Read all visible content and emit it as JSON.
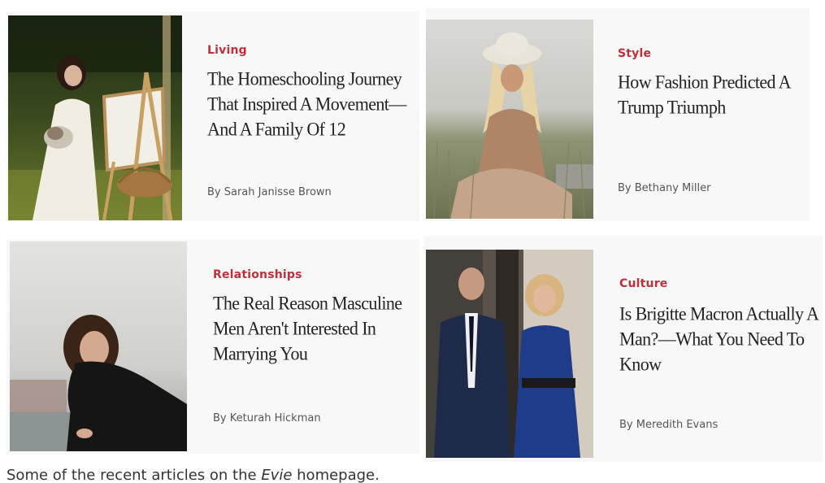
{
  "articles": [
    {
      "category": "Living",
      "headline": "The Homeschooling Journey That Inspired A Movement—And A Family Of 12",
      "byline": "By Sarah Janisse Brown",
      "image": "woman-painting-easel-cat-photo"
    },
    {
      "category": "Style",
      "headline": "How Fashion Predicted A Trump Triumph",
      "byline": "By Bethany Miller",
      "image": "woman-cowboy-hat-field-photo"
    },
    {
      "category": "Relationships",
      "headline": "The Real Reason Masculine Men Aren't Interested In Marrying You",
      "byline": "By Keturah Hickman",
      "image": "woman-leather-jacket-waterfront-photo"
    },
    {
      "category": "Culture",
      "headline": "Is Brigitte Macron Actually A Man?—What You Need To Know",
      "byline": "By Meredith Evans",
      "image": "couple-formal-attire-photo"
    }
  ],
  "caption": {
    "before": "Some of the recent articles on the ",
    "brand": "Evie",
    "after": " homepage."
  },
  "colors": {
    "category": "#c0303a",
    "card_background": "#f8f8f8",
    "headline": "#222222",
    "byline": "#555555"
  }
}
